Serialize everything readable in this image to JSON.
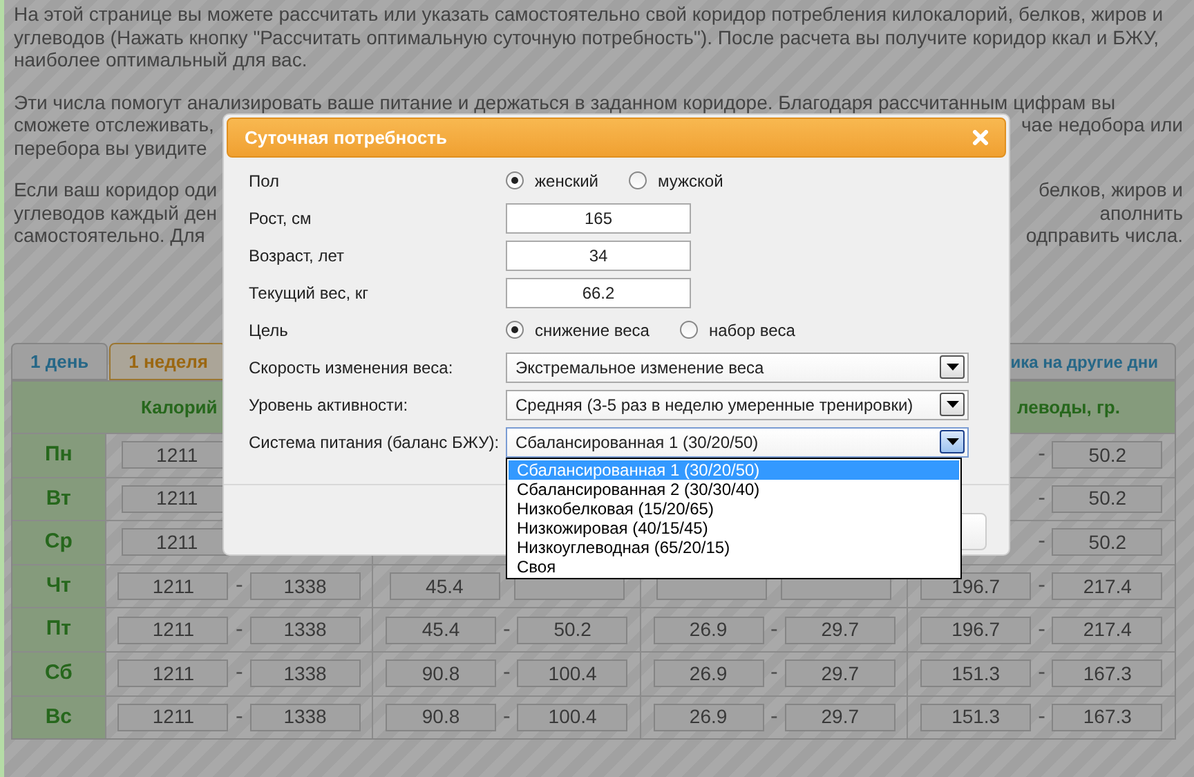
{
  "paragraphs": [
    [
      {
        "left": "На этой странице вы можете рассчитать или указать самостоятельно свой коридор потребления килокалорий, белков, жиров и"
      },
      {
        "left": "углеводов (Нажать кнопку \"Рассчитать оптимальную суточную потребность\"). После расчета вы получите коридор ккал и БЖУ,"
      },
      {
        "left": "наиболее оптимальный для вас."
      }
    ],
    [
      {
        "left": "Эти числа помогут анализировать ваше питание и держаться в заданном коридоре. Благодаря рассчитанным цифрам вы"
      },
      {
        "left": "сможете отслеживать,",
        "right": "чае недобора или"
      },
      {
        "left": "перебора вы увидите"
      }
    ],
    [
      {
        "left": "Если ваш коридор оди",
        "right": "белков, жиров и"
      },
      {
        "left": "углеводов каждый ден",
        "right": "аполнить"
      },
      {
        "left": "самостоятельно. Для",
        "right": "одправить числа."
      }
    ]
  ],
  "tabs": [
    {
      "label": "1 день",
      "selected": false
    },
    {
      "label": "1 неделя",
      "selected": true
    }
  ],
  "tab_right": "ика на другие дни",
  "table": {
    "header_left": "Калорий",
    "header_right": "леводы, гр.",
    "separator": "-",
    "rows": [
      {
        "day": "Пн",
        "cells": [
          "1211",
          null,
          null,
          null,
          null,
          null,
          null,
          "50.2"
        ]
      },
      {
        "day": "Вт",
        "cells": [
          "1211",
          null,
          null,
          null,
          null,
          null,
          null,
          "50.2"
        ]
      },
      {
        "day": "Ср",
        "cells": [
          "1211",
          null,
          null,
          null,
          null,
          null,
          null,
          "50.2"
        ]
      },
      {
        "day": "Чт",
        "cells": [
          "1211",
          "1338",
          "45.4",
          null,
          null,
          null,
          "196.7",
          "217.4"
        ]
      },
      {
        "day": "Пт",
        "cells": [
          "1211",
          "1338",
          "45.4",
          "50.2",
          "26.9",
          "29.7",
          "196.7",
          "217.4"
        ]
      },
      {
        "day": "Сб",
        "cells": [
          "1211",
          "1338",
          "90.8",
          "100.4",
          "26.9",
          "29.7",
          "151.3",
          "167.3"
        ]
      },
      {
        "day": "Вс",
        "cells": [
          "1211",
          "1338",
          "90.8",
          "100.4",
          "26.9",
          "29.7",
          "151.3",
          "167.3"
        ]
      }
    ]
  },
  "dialog": {
    "title": "Суточная потребность",
    "fields": [
      {
        "kind": "radio",
        "label": "Пол",
        "options": [
          {
            "label": "женский",
            "selected": true
          },
          {
            "label": "мужской",
            "selected": false
          }
        ]
      },
      {
        "kind": "input",
        "label": "Рост, см",
        "value": "165"
      },
      {
        "kind": "input",
        "label": "Возраст, лет",
        "value": "34"
      },
      {
        "kind": "input",
        "label": "Текущий вес, кг",
        "value": "66.2"
      },
      {
        "kind": "radio",
        "label": "Цель",
        "options": [
          {
            "label": "снижение веса",
            "selected": true
          },
          {
            "label": "набор веса",
            "selected": false
          }
        ]
      },
      {
        "kind": "select",
        "label": "Скорость изменения веса:",
        "value": "Экстремальное изменение веса",
        "expanded": false
      },
      {
        "kind": "select",
        "label": "Уровень активности:",
        "value": "Средняя (3-5 раз в неделю умеренные тренировки)",
        "expanded": false
      },
      {
        "kind": "select",
        "label": "Система питания (баланс БЖУ):",
        "value": "Сбалансированная 1 (30/20/50)",
        "expanded": true,
        "options": [
          {
            "label": "Сбалансированная 1 (30/20/50)",
            "selected": true
          },
          {
            "label": "Сбалансированная 2 (30/30/40)",
            "selected": false
          },
          {
            "label": "Низкобелковая (15/20/65)",
            "selected": false
          },
          {
            "label": "Низкожировая (40/15/45)",
            "selected": false
          },
          {
            "label": "Низкоуглеводная (65/20/15)",
            "selected": false
          },
          {
            "label": "Своя",
            "selected": false
          }
        ]
      }
    ]
  }
}
